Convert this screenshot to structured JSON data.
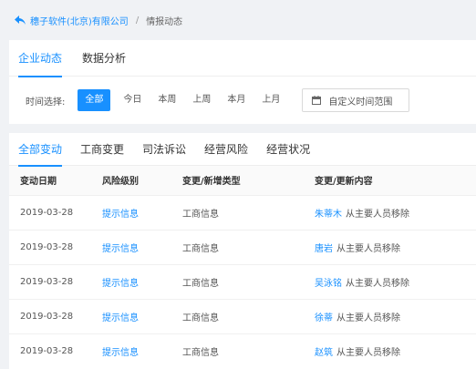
{
  "breadcrumb": {
    "company": "穗子软件(北京)有限公司",
    "separator": "/",
    "current": "情报动态"
  },
  "top_tabs": [
    {
      "label": "企业动态",
      "active": true
    },
    {
      "label": "数据分析",
      "active": false
    }
  ],
  "time_filter": {
    "label": "时间选择:",
    "options": [
      {
        "label": "全部",
        "active": true
      },
      {
        "label": "今日",
        "active": false
      },
      {
        "label": "本周",
        "active": false
      },
      {
        "label": "上周",
        "active": false
      },
      {
        "label": "本月",
        "active": false
      },
      {
        "label": "上月",
        "active": false
      }
    ],
    "custom_range_label": "自定义时间范围"
  },
  "sub_tabs": [
    {
      "label": "全部变动",
      "active": true
    },
    {
      "label": "工商变更",
      "active": false
    },
    {
      "label": "司法诉讼",
      "active": false
    },
    {
      "label": "经营风险",
      "active": false
    },
    {
      "label": "经营状况",
      "active": false
    }
  ],
  "table": {
    "headers": [
      "变动日期",
      "风险级别",
      "变更/新增类型",
      "变更/更新内容"
    ],
    "rows": [
      {
        "date": "2019-03-28",
        "risk": "提示信息",
        "type": "工商信息",
        "person": "朱蒂木",
        "content": "从主要人员移除"
      },
      {
        "date": "2019-03-28",
        "risk": "提示信息",
        "type": "工商信息",
        "person": "唐岩",
        "content": "从主要人员移除"
      },
      {
        "date": "2019-03-28",
        "risk": "提示信息",
        "type": "工商信息",
        "person": "吴泳铭",
        "content": "从主要人员移除"
      },
      {
        "date": "2019-03-28",
        "risk": "提示信息",
        "type": "工商信息",
        "person": "徐蒂",
        "content": "从主要人员移除"
      },
      {
        "date": "2019-03-28",
        "risk": "提示信息",
        "type": "工商信息",
        "person": "赵筑",
        "content": "从主要人员移除"
      }
    ]
  },
  "colors": {
    "accent": "#1890ff",
    "page_background": "#f0f2f5",
    "card_background": "#ffffff"
  },
  "icons": {
    "back": "back-arrow-icon",
    "calendar": "calendar-icon"
  }
}
